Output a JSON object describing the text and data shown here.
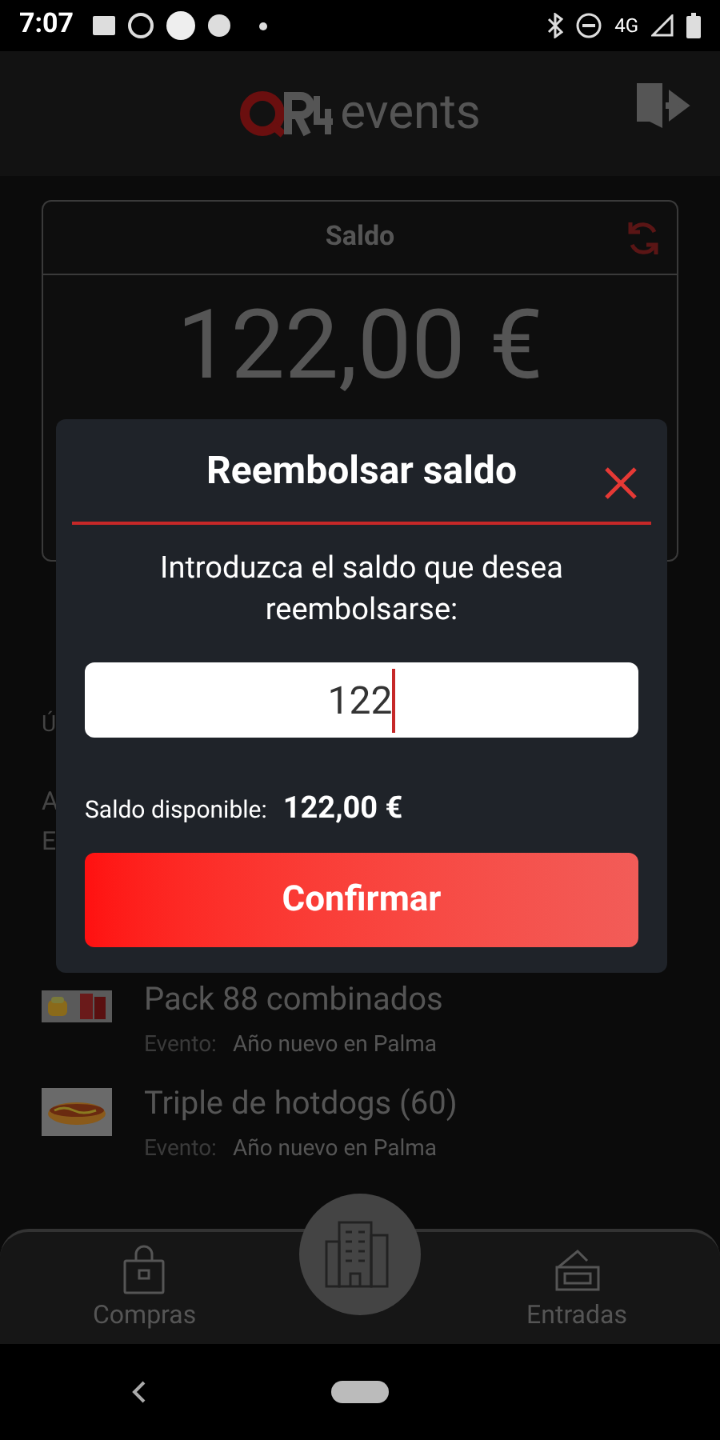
{
  "status_bar": {
    "time": "7:07",
    "network": "4G"
  },
  "header": {
    "logo_text": "events"
  },
  "balance_card": {
    "title": "Saldo",
    "amount": "122,00 €"
  },
  "covered_fragments": [
    {
      "kind": "small",
      "text": "Ú"
    },
    {
      "kind": "body",
      "text": "A"
    },
    {
      "kind": "body",
      "text": "E"
    }
  ],
  "purchases": [
    {
      "name": "Pack 88 combinados",
      "event_label": "Evento:",
      "event": "Año nuevo en Palma",
      "kind": "drinks"
    },
    {
      "name": "Triple de hotdogs (60)",
      "event_label": "Evento:",
      "event": "Año nuevo en Palma",
      "kind": "hotdog"
    }
  ],
  "bottom_nav": [
    {
      "kind": "bag",
      "label": "Compras"
    },
    {
      "kind": "building"
    },
    {
      "kind": "ticket",
      "label": "Entradas"
    }
  ],
  "dialog": {
    "title": "Reembolsar saldo",
    "prompt": "Introduzca el saldo que desea reembolsarse:",
    "value": "122",
    "available_label": "Saldo disponible:",
    "available_value": "122,00 €",
    "confirm": "Confirmar"
  }
}
